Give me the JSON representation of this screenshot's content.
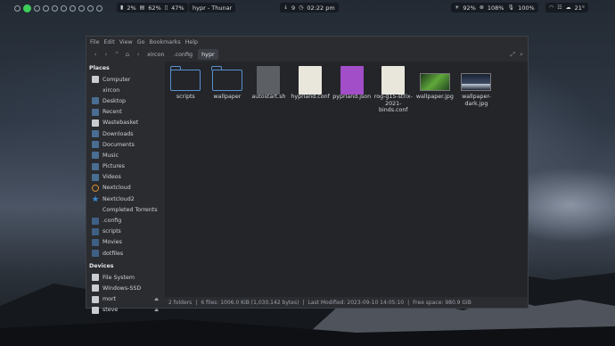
{
  "topbar": {
    "workspaces": [
      "",
      "",
      "",
      "",
      "",
      "",
      "",
      "",
      "",
      ""
    ],
    "active_workspace_index": 1,
    "battery_pct": "2%",
    "memory_pct": "62%",
    "disk_pct": "47%",
    "window_title": "hypr - Thunar",
    "downloads": "9",
    "clock": "02:22 pm",
    "brightness": "92%",
    "volume": "108%",
    "mic": "100%",
    "temperature": "21°"
  },
  "menubar": [
    "File",
    "Edit",
    "View",
    "Go",
    "Bookmarks",
    "Help"
  ],
  "breadcrumb": [
    "xircon",
    ".config",
    "hypr"
  ],
  "sidebar": {
    "places_label": "Places",
    "places": [
      {
        "label": "Computer",
        "icon": "computer-icon"
      },
      {
        "label": "xircon",
        "icon": "home-icon"
      },
      {
        "label": "Desktop",
        "icon": "desktop-icon"
      },
      {
        "label": "Recent",
        "icon": "recent-icon"
      },
      {
        "label": "Wastebasket",
        "icon": "trash-icon"
      },
      {
        "label": "Downloads",
        "icon": "downloads-icon"
      },
      {
        "label": "Documents",
        "icon": "documents-icon"
      },
      {
        "label": "Music",
        "icon": "music-icon"
      },
      {
        "label": "Pictures",
        "icon": "pictures-icon"
      },
      {
        "label": "Videos",
        "icon": "videos-icon"
      },
      {
        "label": "Nextcloud",
        "icon": "nextcloud-icon"
      },
      {
        "label": "Nextcloud2",
        "icon": "nextcloud-star-icon"
      },
      {
        "label": "Completed Torrents",
        "icon": "torrents-icon"
      },
      {
        "label": ".config",
        "icon": "folder-icon"
      },
      {
        "label": "scripts",
        "icon": "folder-icon"
      },
      {
        "label": "Movies",
        "icon": "folder-icon"
      },
      {
        "label": "dotfiles",
        "icon": "folder-icon"
      }
    ],
    "devices_label": "Devices",
    "devices": [
      {
        "label": "File System",
        "eject": false
      },
      {
        "label": "Windows-SSD",
        "eject": false
      },
      {
        "label": "mort",
        "eject": true
      },
      {
        "label": "steve",
        "eject": true
      }
    ]
  },
  "files": [
    {
      "name": "scripts",
      "kind": "folder"
    },
    {
      "name": "wallpaper",
      "kind": "folder"
    },
    {
      "name": "autostart.sh",
      "kind": "shell"
    },
    {
      "name": "hyprland.conf",
      "kind": "text"
    },
    {
      "name": "pyprland.json",
      "kind": "json"
    },
    {
      "name": "rog-g15-strix-2021-binds.conf",
      "kind": "text"
    },
    {
      "name": "wallpaper.jpg",
      "kind": "image-green"
    },
    {
      "name": "wallpaper-dark.jpg",
      "kind": "image-dark"
    }
  ],
  "status": {
    "folders": "2 folders",
    "files": "6 files: 1006.0 KiB (1,030,142 bytes)",
    "modified": "Last Modified: 2023-09-10 14:05:10",
    "free": "Free space: 980.9 GiB"
  }
}
